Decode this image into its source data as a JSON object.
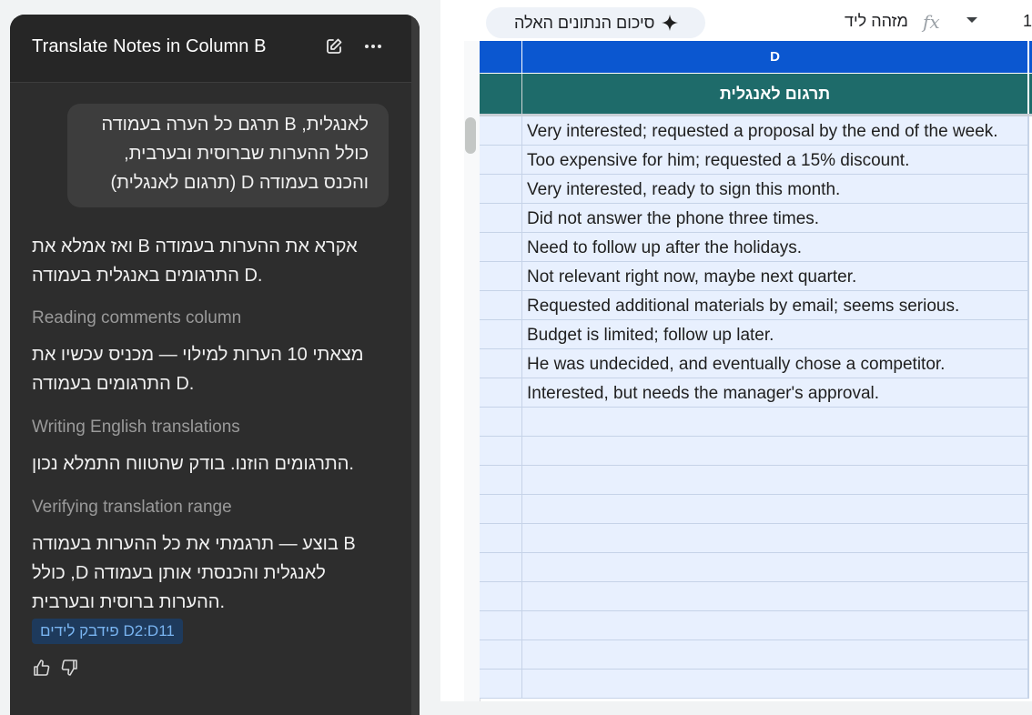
{
  "chat": {
    "title": "Translate Notes in Column B",
    "user_message_lines": [
      "לאנגלית, B תרגם כל הערה בעמודה",
      "כולל ההערות שברוסית ובערבית,",
      "והכנס בעמודה D (תרגום לאנגלית)"
    ],
    "assistant_intro_lines": [
      "ואז אמלא את B אקרא את ההערות בעמודה",
      "התרגומים באנגלית בעמודה D."
    ],
    "steps": [
      {
        "label": "Reading comments column",
        "text_lines": [
          "מצאתי 10 הערות למילוי — מכניס עכשיו את",
          "התרגומים בעמודה D."
        ]
      },
      {
        "label": "Writing English translations",
        "text_lines": [
          "התרגומים הוזנו. בודק שהטווח התמלא נכון."
        ]
      },
      {
        "label": "Verifying translation range",
        "text_lines": [
          "בוצע — תרגמתי את כל ההערות בעמודה B",
          "כולל ,D לאנגלית והכנסתי אותן בעמודה",
          "ההערות ברוסית ובערבית."
        ]
      }
    ],
    "range_chip": "פידבק לידים D2:D11",
    "icons": {
      "edit": "edit-pencil-icon",
      "more": "more-horizontal-icon",
      "thumbs_up": "thumbs-up-icon",
      "thumbs_down": "thumbs-down-icon"
    }
  },
  "toolbar": {
    "ai_summary_label": "סיכום הנתונים האלה",
    "name_box_label": "מזהה ליד",
    "fx_label": "fx",
    "cell_ref": "1"
  },
  "sheet": {
    "column_header": "D",
    "title_cell": "תרגום לאנגלית",
    "rows": [
      "Very interested; requested a proposal by the end of the week.",
      "Too expensive for him; requested a 15% discount.",
      "Very interested, ready to sign this month.",
      "Did not answer the phone three times.",
      "Need to follow up after the holidays.",
      "Not relevant right now, maybe next quarter.",
      "Requested additional materials by email; seems serious.",
      "Budget is limited; follow up later.",
      "He was undecided, and eventually chose a competitor.",
      "Interested, but needs the manager's approval.",
      "",
      "",
      "",
      "",
      "",
      "",
      "",
      "",
      "",
      ""
    ]
  },
  "colors": {
    "chat_bg": "#2d2d2d",
    "header_blue": "#0b57d0",
    "title_teal": "#1e6b6a",
    "cell_bg": "#e8f0fe",
    "chip_text": "#79b4f0"
  }
}
